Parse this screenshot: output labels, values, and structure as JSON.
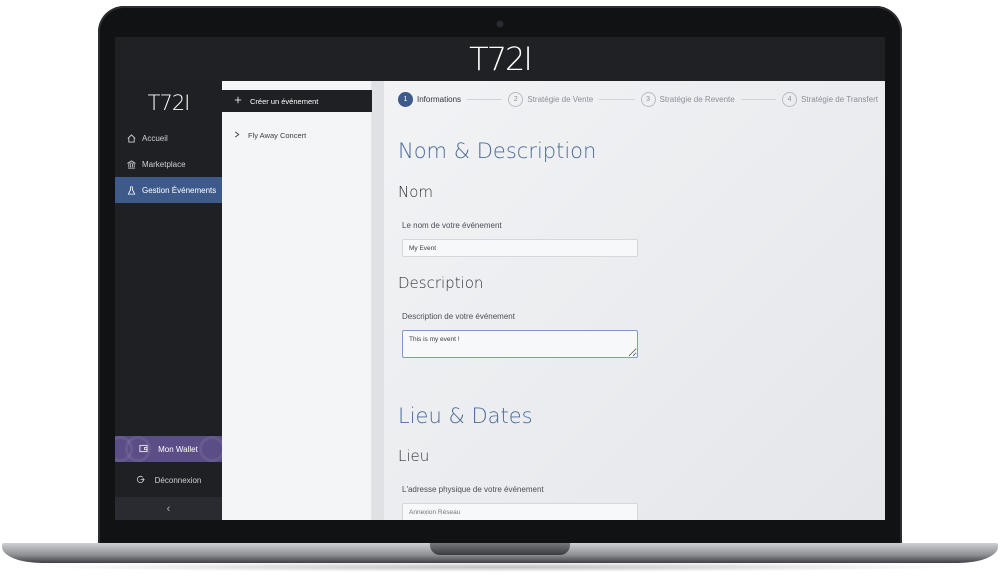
{
  "app": {
    "brand": "T72I",
    "sidebar_brand": "T72I"
  },
  "sidebar": {
    "items": [
      {
        "label": "Accueil",
        "icon": "home-icon",
        "glyph": "⌂",
        "active": false
      },
      {
        "label": "Marketplace",
        "icon": "bank-icon",
        "glyph": "⌂",
        "active": false
      },
      {
        "label": "Gestion Événements",
        "icon": "flask-icon",
        "glyph": "⚗",
        "active": true
      }
    ],
    "wallet_label": "Mon Wallet",
    "logout_label": "Déconnexion",
    "collapse_glyph": "‹"
  },
  "events": {
    "create_label": "Créer un événement",
    "items": [
      {
        "label": "Fly Away Concert"
      }
    ]
  },
  "stepper": {
    "steps": [
      {
        "num": "1",
        "label": "Informations",
        "active": true
      },
      {
        "num": "2",
        "label": "Stratégie de Vente",
        "active": false
      },
      {
        "num": "3",
        "label": "Stratégie de Revente",
        "active": false
      },
      {
        "num": "4",
        "label": "Stratégie de Transfert",
        "active": false
      }
    ]
  },
  "form": {
    "section1_title": "Nom & Description",
    "name_title": "Nom",
    "name_label": "Le nom de votre événement",
    "name_value": "My Event",
    "desc_title": "Description",
    "desc_label": "Description de votre événement",
    "desc_value": "This is my event !",
    "section2_title": "Lieu & Dates",
    "place_title": "Lieu",
    "place_label": "L'adresse physique de votre événement",
    "place_placeholder": "Annexion Réseau"
  },
  "colors": {
    "accent": "#3d5a8a",
    "wallet": "#5b4d86",
    "dark": "#1f2024"
  }
}
